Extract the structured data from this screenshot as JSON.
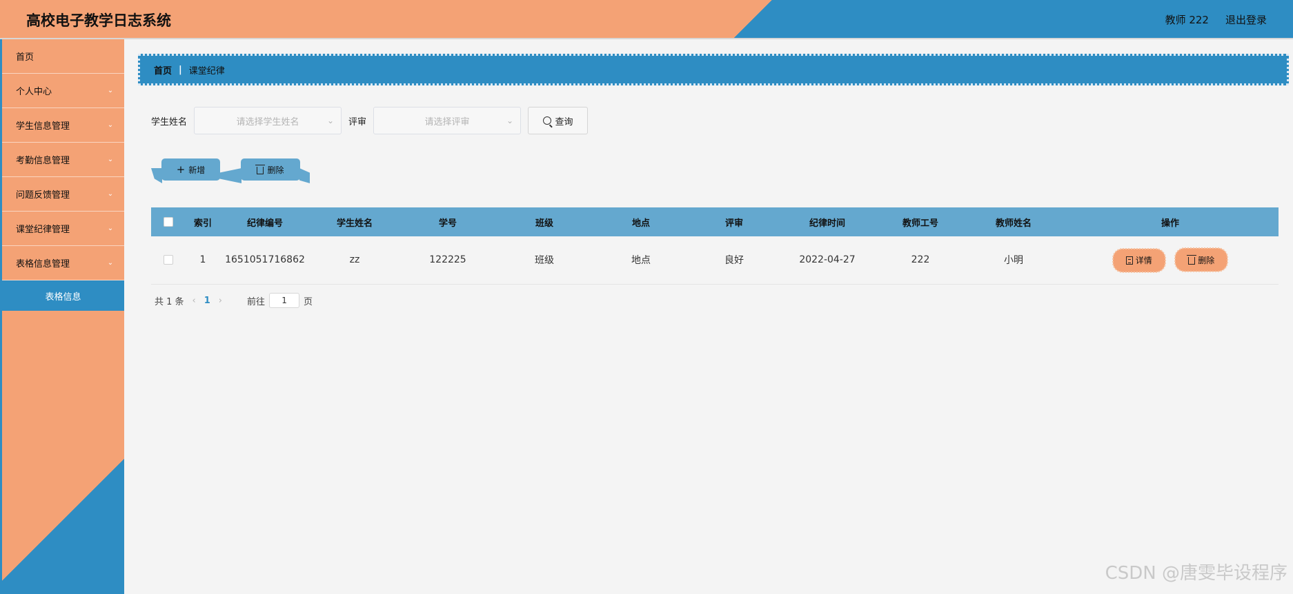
{
  "header": {
    "title": "高校电子教学日志系统",
    "user": "教师 222",
    "logout": "退出登录"
  },
  "sidebar": {
    "items": [
      {
        "label": "首页",
        "expandable": false
      },
      {
        "label": "个人中心",
        "expandable": true
      },
      {
        "label": "学生信息管理",
        "expandable": true
      },
      {
        "label": "考勤信息管理",
        "expandable": true
      },
      {
        "label": "问题反馈管理",
        "expandable": true
      },
      {
        "label": "课堂纪律管理",
        "expandable": true
      },
      {
        "label": "表格信息管理",
        "expandable": true
      }
    ],
    "active_sub": "表格信息"
  },
  "breadcrumb": {
    "home": "首页",
    "separator": "|",
    "current": "课堂纪律"
  },
  "search": {
    "student_label": "学生姓名",
    "student_placeholder": "请选择学生姓名",
    "review_label": "评审",
    "review_placeholder": "请选择评审",
    "query_button": "查询"
  },
  "actions": {
    "add": "新增",
    "delete": "删除"
  },
  "table": {
    "headers": [
      "索引",
      "纪律编号",
      "学生姓名",
      "学号",
      "班级",
      "地点",
      "评审",
      "纪律时间",
      "教师工号",
      "教师姓名",
      "操作"
    ],
    "rows": [
      {
        "index": "1",
        "number": "1651051716862",
        "student": "zz",
        "student_id": "122225",
        "class": "班级",
        "location": "地点",
        "review": "良好",
        "time": "2022-04-27",
        "teacher_id": "222",
        "teacher_name": "小明",
        "detail": "详情",
        "delete": "删除"
      }
    ]
  },
  "pagination": {
    "total": "共 1 条",
    "prev": "‹",
    "current_page": "1",
    "next": "›",
    "goto_label": "前往",
    "goto_value": "1",
    "page_suffix": "页"
  },
  "watermark": "CSDN @唐雯毕设程序",
  "colors": {
    "accent_orange": "#f4a275",
    "accent_blue": "#2e8dc3",
    "table_header": "#64a8cf"
  }
}
